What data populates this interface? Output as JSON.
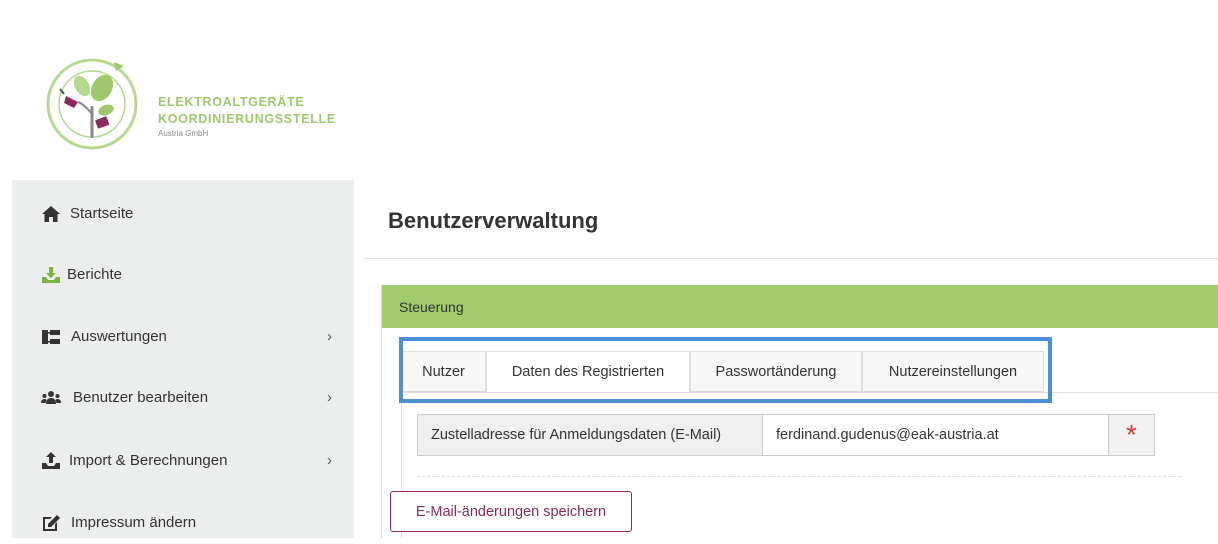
{
  "brand": {
    "line1": "ELEKTROALTGERÄTE",
    "line2": "KOORDINIERUNGSSTELLE",
    "line3": "Austria GmbH",
    "accent_color": "#9dc96a"
  },
  "sidebar": {
    "items": [
      {
        "label": "Startseite",
        "icon": "home-icon",
        "has_submenu": false
      },
      {
        "label": "Berichte",
        "icon": "download-tray-icon",
        "has_submenu": false
      },
      {
        "label": "Auswertungen",
        "icon": "sitemap-icon",
        "has_submenu": true
      },
      {
        "label": "Benutzer bearbeiten",
        "icon": "users-icon",
        "has_submenu": true
      },
      {
        "label": "Import & Berechnungen",
        "icon": "upload-tray-icon",
        "has_submenu": true
      },
      {
        "label": "Impressum ändern",
        "icon": "edit-icon",
        "has_submenu": false
      }
    ],
    "chevron": "›"
  },
  "main": {
    "title": "Benutzerverwaltung",
    "panel": {
      "heading": "Steuerung",
      "heading_color": "#a0cc6c",
      "tabs": [
        {
          "label": "Nutzer",
          "active": false
        },
        {
          "label": "Daten des Registrierten",
          "active": true
        },
        {
          "label": "Passwortänderung",
          "active": false
        },
        {
          "label": "Nutzereinstellungen",
          "active": false
        }
      ],
      "email_field": {
        "label": "Zustelladresse für Anmeldungsdaten (E-Mail)",
        "value": "ferdinand.gudenus@eak-austria.at",
        "required_mark": "*"
      },
      "save_button": "E-Mail-änderungen speichern",
      "button_color": "#8a2a5e"
    }
  },
  "annotation": {
    "highlight_color": "#4b8fd6"
  }
}
